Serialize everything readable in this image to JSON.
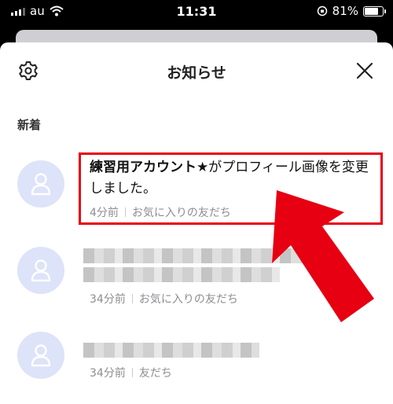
{
  "status_bar": {
    "carrier": "au",
    "time": "11:31",
    "battery_percent": "81%",
    "battery_level": 0.81
  },
  "header": {
    "title": "お知らせ"
  },
  "section": {
    "label": "新着"
  },
  "notifications": [
    {
      "name": "練習用アカウント★",
      "text": "がプロフィール画像を変更しました。",
      "time": "4分前",
      "category": "お気に入りの友だち"
    },
    {
      "time": "34分前",
      "category": "お気に入りの友だち"
    },
    {
      "time": "34分前",
      "category": "友だち"
    }
  ],
  "colors": {
    "highlight": "#e60012",
    "avatar_bg": "#dde3f8"
  }
}
